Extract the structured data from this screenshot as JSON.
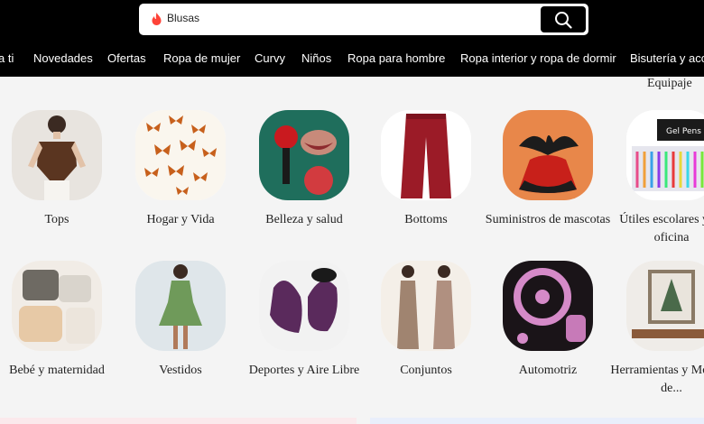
{
  "search": {
    "value": "Blusas",
    "icon": "flame-icon",
    "button_icon": "search-icon"
  },
  "nav": [
    {
      "label": "a ti"
    },
    {
      "label": "Novedades"
    },
    {
      "label": "Ofertas"
    },
    {
      "label": "Ropa de mujer"
    },
    {
      "label": "Curvy"
    },
    {
      "label": "Niños"
    },
    {
      "label": "Ropa para hombre"
    },
    {
      "label": "Ropa interior y ropa de dormir"
    },
    {
      "label": "Bisutería y acc"
    }
  ],
  "partial_label": "Equipaje",
  "categories_row1": [
    {
      "label": "Tops"
    },
    {
      "label": "Hogar y Vida"
    },
    {
      "label": "Belleza y salud"
    },
    {
      "label": "Bottoms"
    },
    {
      "label": "Suministros de mascotas"
    },
    {
      "label": "Útiles escolares y de oficina"
    }
  ],
  "categories_row2": [
    {
      "label": "Bebé y maternidad"
    },
    {
      "label": "Vestidos"
    },
    {
      "label": "Deportes y Aire Libre"
    },
    {
      "label": "Conjuntos"
    },
    {
      "label": "Automotriz"
    },
    {
      "label": "Herramientas y Mejoras de..."
    }
  ],
  "colors": {
    "header_bg": "#000000",
    "page_bg": "#f4f4f4",
    "accent": "#fe4338"
  }
}
